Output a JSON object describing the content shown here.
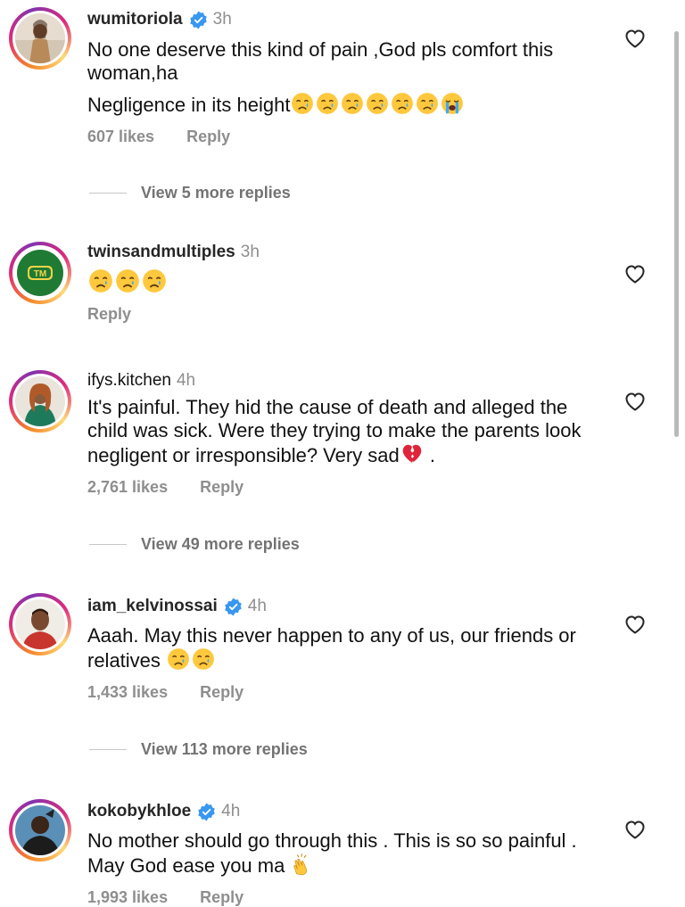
{
  "comments": [
    {
      "username": "wumitoriola",
      "verified": true,
      "time": "3h",
      "lines": [
        "No one deserve this kind of pain ,God pls comfort this woman,ha",
        "Negligence in its height"
      ],
      "emojis": [
        "crying-face",
        "crying-face",
        "crying-face",
        "crying-face",
        "crying-face",
        "crying-face",
        "loudly-crying-face"
      ],
      "likes": "607 likes",
      "reply": "Reply",
      "view_replies": "View 5 more replies"
    },
    {
      "username": "twinsandmultiples",
      "verified": false,
      "time": "3h",
      "avatar_text": "TM",
      "emojis": [
        "crying-face",
        "crying-face",
        "crying-face"
      ],
      "reply": "Reply"
    },
    {
      "username": "ifys.kitchen",
      "verified": false,
      "time": "4h",
      "lines": [
        "It's painful. They hid the cause of death and alleged the child was sick. Were they trying to make the parents look negligent or irresponsible? Very sad"
      ],
      "trailing": ".",
      "emojis": [
        "broken-heart"
      ],
      "likes": "2,761 likes",
      "reply": "Reply",
      "view_replies": "View 49 more replies"
    },
    {
      "username": "iam_kelvinossai",
      "verified": true,
      "time": "4h",
      "lines": [
        "Aaah. May this never happen to any of us, our friends or relatives"
      ],
      "emojis": [
        "crying-face",
        "crying-face"
      ],
      "likes": "1,433 likes",
      "reply": "Reply",
      "view_replies": "View 113 more replies"
    },
    {
      "username": "kokobykhloe",
      "verified": true,
      "time": "4h",
      "lines": [
        "No mother should go through this . This is so so painful . May God ease you ma"
      ],
      "emojis": [
        "clapping-hands"
      ],
      "likes": "1,993 likes",
      "reply": "Reply"
    }
  ],
  "colors": {
    "text": "#111111",
    "muted": "#8e8e8e",
    "verified_blue": "#3897f0",
    "story_ring": [
      "#f58529",
      "#dd2a7b",
      "#8134af"
    ]
  }
}
